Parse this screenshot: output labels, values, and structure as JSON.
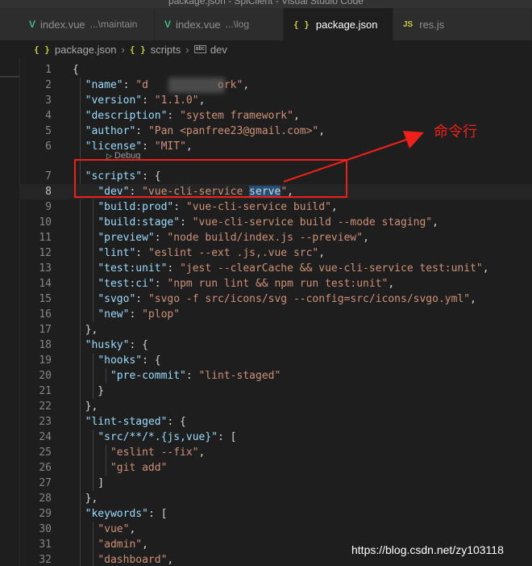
{
  "window": {
    "title": "package.json - SpiClient - Visual Studio Code"
  },
  "tabs": [
    {
      "label": "index.vue",
      "desc": "...\\maintain"
    },
    {
      "label": "index.vue",
      "desc": "...\\log"
    },
    {
      "label": "package.json",
      "desc": ""
    },
    {
      "label": "res.js",
      "desc": ""
    }
  ],
  "icons": {
    "vue": "V",
    "json": "{ }",
    "js": "JS",
    "close": "×",
    "chevron": "›",
    "abc": "abc",
    "play": "▷"
  },
  "breadcrumb": {
    "file": "package.json",
    "section": "scripts",
    "item": "dev"
  },
  "codelens": {
    "label": "Debug"
  },
  "editor": {
    "current_line": 8,
    "lines": [
      {
        "n": "1",
        "parts": [
          [
            "p",
            "{"
          ]
        ]
      },
      {
        "n": "2",
        "parts": [
          [
            "p",
            "  "
          ],
          [
            "k",
            "\"name\""
          ],
          [
            "p",
            ": "
          ],
          [
            "s",
            "\"d           ork\""
          ],
          [
            "p",
            ","
          ]
        ]
      },
      {
        "n": "3",
        "parts": [
          [
            "p",
            "  "
          ],
          [
            "k",
            "\"version\""
          ],
          [
            "p",
            ": "
          ],
          [
            "s",
            "\"1.1.0\""
          ],
          [
            "p",
            ","
          ]
        ]
      },
      {
        "n": "4",
        "parts": [
          [
            "p",
            "  "
          ],
          [
            "k",
            "\"description\""
          ],
          [
            "p",
            ": "
          ],
          [
            "s",
            "\"system framework\""
          ],
          [
            "p",
            ","
          ]
        ]
      },
      {
        "n": "5",
        "parts": [
          [
            "p",
            "  "
          ],
          [
            "k",
            "\"author\""
          ],
          [
            "p",
            ": "
          ],
          [
            "s",
            "\"Pan <panfree23@gmail.com>\""
          ],
          [
            "p",
            ","
          ]
        ]
      },
      {
        "n": "6",
        "parts": [
          [
            "p",
            "  "
          ],
          [
            "k",
            "\"license\""
          ],
          [
            "p",
            ": "
          ],
          [
            "s",
            "\"MIT\""
          ],
          [
            "p",
            ","
          ]
        ]
      },
      {
        "n": "7",
        "parts": [
          [
            "p",
            "  "
          ],
          [
            "k",
            "\"scripts\""
          ],
          [
            "p",
            ": {"
          ]
        ]
      },
      {
        "n": "8",
        "parts": [
          [
            "p",
            "    "
          ],
          [
            "k",
            "\"dev\""
          ],
          [
            "p",
            ": "
          ],
          [
            "s",
            "\"vue-cli-service "
          ],
          [
            "hl",
            "serve"
          ],
          [
            "s",
            "\""
          ],
          [
            "p",
            ","
          ]
        ]
      },
      {
        "n": "9",
        "parts": [
          [
            "p",
            "    "
          ],
          [
            "k",
            "\"build:prod\""
          ],
          [
            "p",
            ": "
          ],
          [
            "s",
            "\"vue-cli-service build\""
          ],
          [
            "p",
            ","
          ]
        ]
      },
      {
        "n": "10",
        "parts": [
          [
            "p",
            "    "
          ],
          [
            "k",
            "\"build:stage\""
          ],
          [
            "p",
            ": "
          ],
          [
            "s",
            "\"vue-cli-service build --mode staging\""
          ],
          [
            "p",
            ","
          ]
        ]
      },
      {
        "n": "11",
        "parts": [
          [
            "p",
            "    "
          ],
          [
            "k",
            "\"preview\""
          ],
          [
            "p",
            ": "
          ],
          [
            "s",
            "\"node build/index.js --preview\""
          ],
          [
            "p",
            ","
          ]
        ]
      },
      {
        "n": "12",
        "parts": [
          [
            "p",
            "    "
          ],
          [
            "k",
            "\"lint\""
          ],
          [
            "p",
            ": "
          ],
          [
            "s",
            "\"eslint --ext .js,.vue src\""
          ],
          [
            "p",
            ","
          ]
        ]
      },
      {
        "n": "13",
        "parts": [
          [
            "p",
            "    "
          ],
          [
            "k",
            "\"test:unit\""
          ],
          [
            "p",
            ": "
          ],
          [
            "s",
            "\"jest --clearCache && vue-cli-service test:unit\""
          ],
          [
            "p",
            ","
          ]
        ]
      },
      {
        "n": "14",
        "parts": [
          [
            "p",
            "    "
          ],
          [
            "k",
            "\"test:ci\""
          ],
          [
            "p",
            ": "
          ],
          [
            "s",
            "\"npm run lint && npm run test:unit\""
          ],
          [
            "p",
            ","
          ]
        ]
      },
      {
        "n": "15",
        "parts": [
          [
            "p",
            "    "
          ],
          [
            "k",
            "\"svgo\""
          ],
          [
            "p",
            ": "
          ],
          [
            "s",
            "\"svgo -f src/icons/svg --config=src/icons/svgo.yml\""
          ],
          [
            "p",
            ","
          ]
        ]
      },
      {
        "n": "16",
        "parts": [
          [
            "p",
            "    "
          ],
          [
            "k",
            "\"new\""
          ],
          [
            "p",
            ": "
          ],
          [
            "s",
            "\"plop\""
          ]
        ]
      },
      {
        "n": "17",
        "parts": [
          [
            "p",
            "  },"
          ]
        ]
      },
      {
        "n": "18",
        "parts": [
          [
            "p",
            "  "
          ],
          [
            "k",
            "\"husky\""
          ],
          [
            "p",
            ": {"
          ]
        ]
      },
      {
        "n": "19",
        "parts": [
          [
            "p",
            "    "
          ],
          [
            "k",
            "\"hooks\""
          ],
          [
            "p",
            ": {"
          ]
        ]
      },
      {
        "n": "20",
        "parts": [
          [
            "p",
            "      "
          ],
          [
            "k",
            "\"pre-commit\""
          ],
          [
            "p",
            ": "
          ],
          [
            "s",
            "\"lint-staged\""
          ]
        ]
      },
      {
        "n": "21",
        "parts": [
          [
            "p",
            "    }"
          ]
        ]
      },
      {
        "n": "22",
        "parts": [
          [
            "p",
            "  },"
          ]
        ]
      },
      {
        "n": "23",
        "parts": [
          [
            "p",
            "  "
          ],
          [
            "k",
            "\"lint-staged\""
          ],
          [
            "p",
            ": {"
          ]
        ]
      },
      {
        "n": "24",
        "parts": [
          [
            "p",
            "    "
          ],
          [
            "k",
            "\"src/**/*.{js,vue}\""
          ],
          [
            "p",
            ": ["
          ]
        ]
      },
      {
        "n": "25",
        "parts": [
          [
            "p",
            "      "
          ],
          [
            "s",
            "\"eslint --fix\""
          ],
          [
            "p",
            ","
          ]
        ]
      },
      {
        "n": "26",
        "parts": [
          [
            "p",
            "      "
          ],
          [
            "s",
            "\"git add\""
          ]
        ]
      },
      {
        "n": "27",
        "parts": [
          [
            "p",
            "    ]"
          ]
        ]
      },
      {
        "n": "28",
        "parts": [
          [
            "p",
            "  },"
          ]
        ]
      },
      {
        "n": "29",
        "parts": [
          [
            "p",
            "  "
          ],
          [
            "k",
            "\"keywords\""
          ],
          [
            "p",
            ": ["
          ]
        ]
      },
      {
        "n": "30",
        "parts": [
          [
            "p",
            "    "
          ],
          [
            "s",
            "\"vue\""
          ],
          [
            "p",
            ","
          ]
        ]
      },
      {
        "n": "31",
        "parts": [
          [
            "p",
            "    "
          ],
          [
            "s",
            "\"admin\""
          ],
          [
            "p",
            ","
          ]
        ]
      },
      {
        "n": "32",
        "parts": [
          [
            "p",
            "    "
          ],
          [
            "s",
            "\"dashboard\""
          ],
          [
            "p",
            ","
          ]
        ]
      }
    ]
  },
  "annotation": {
    "label": "命令行",
    "color": "#f0201a"
  },
  "watermark": {
    "text": "https://blog.csdn.net/zy103118"
  },
  "colors": {
    "editor_bg": "#1e1e1e",
    "key": "#9cdcfe",
    "string": "#ce9178",
    "selection": "#264f78"
  }
}
